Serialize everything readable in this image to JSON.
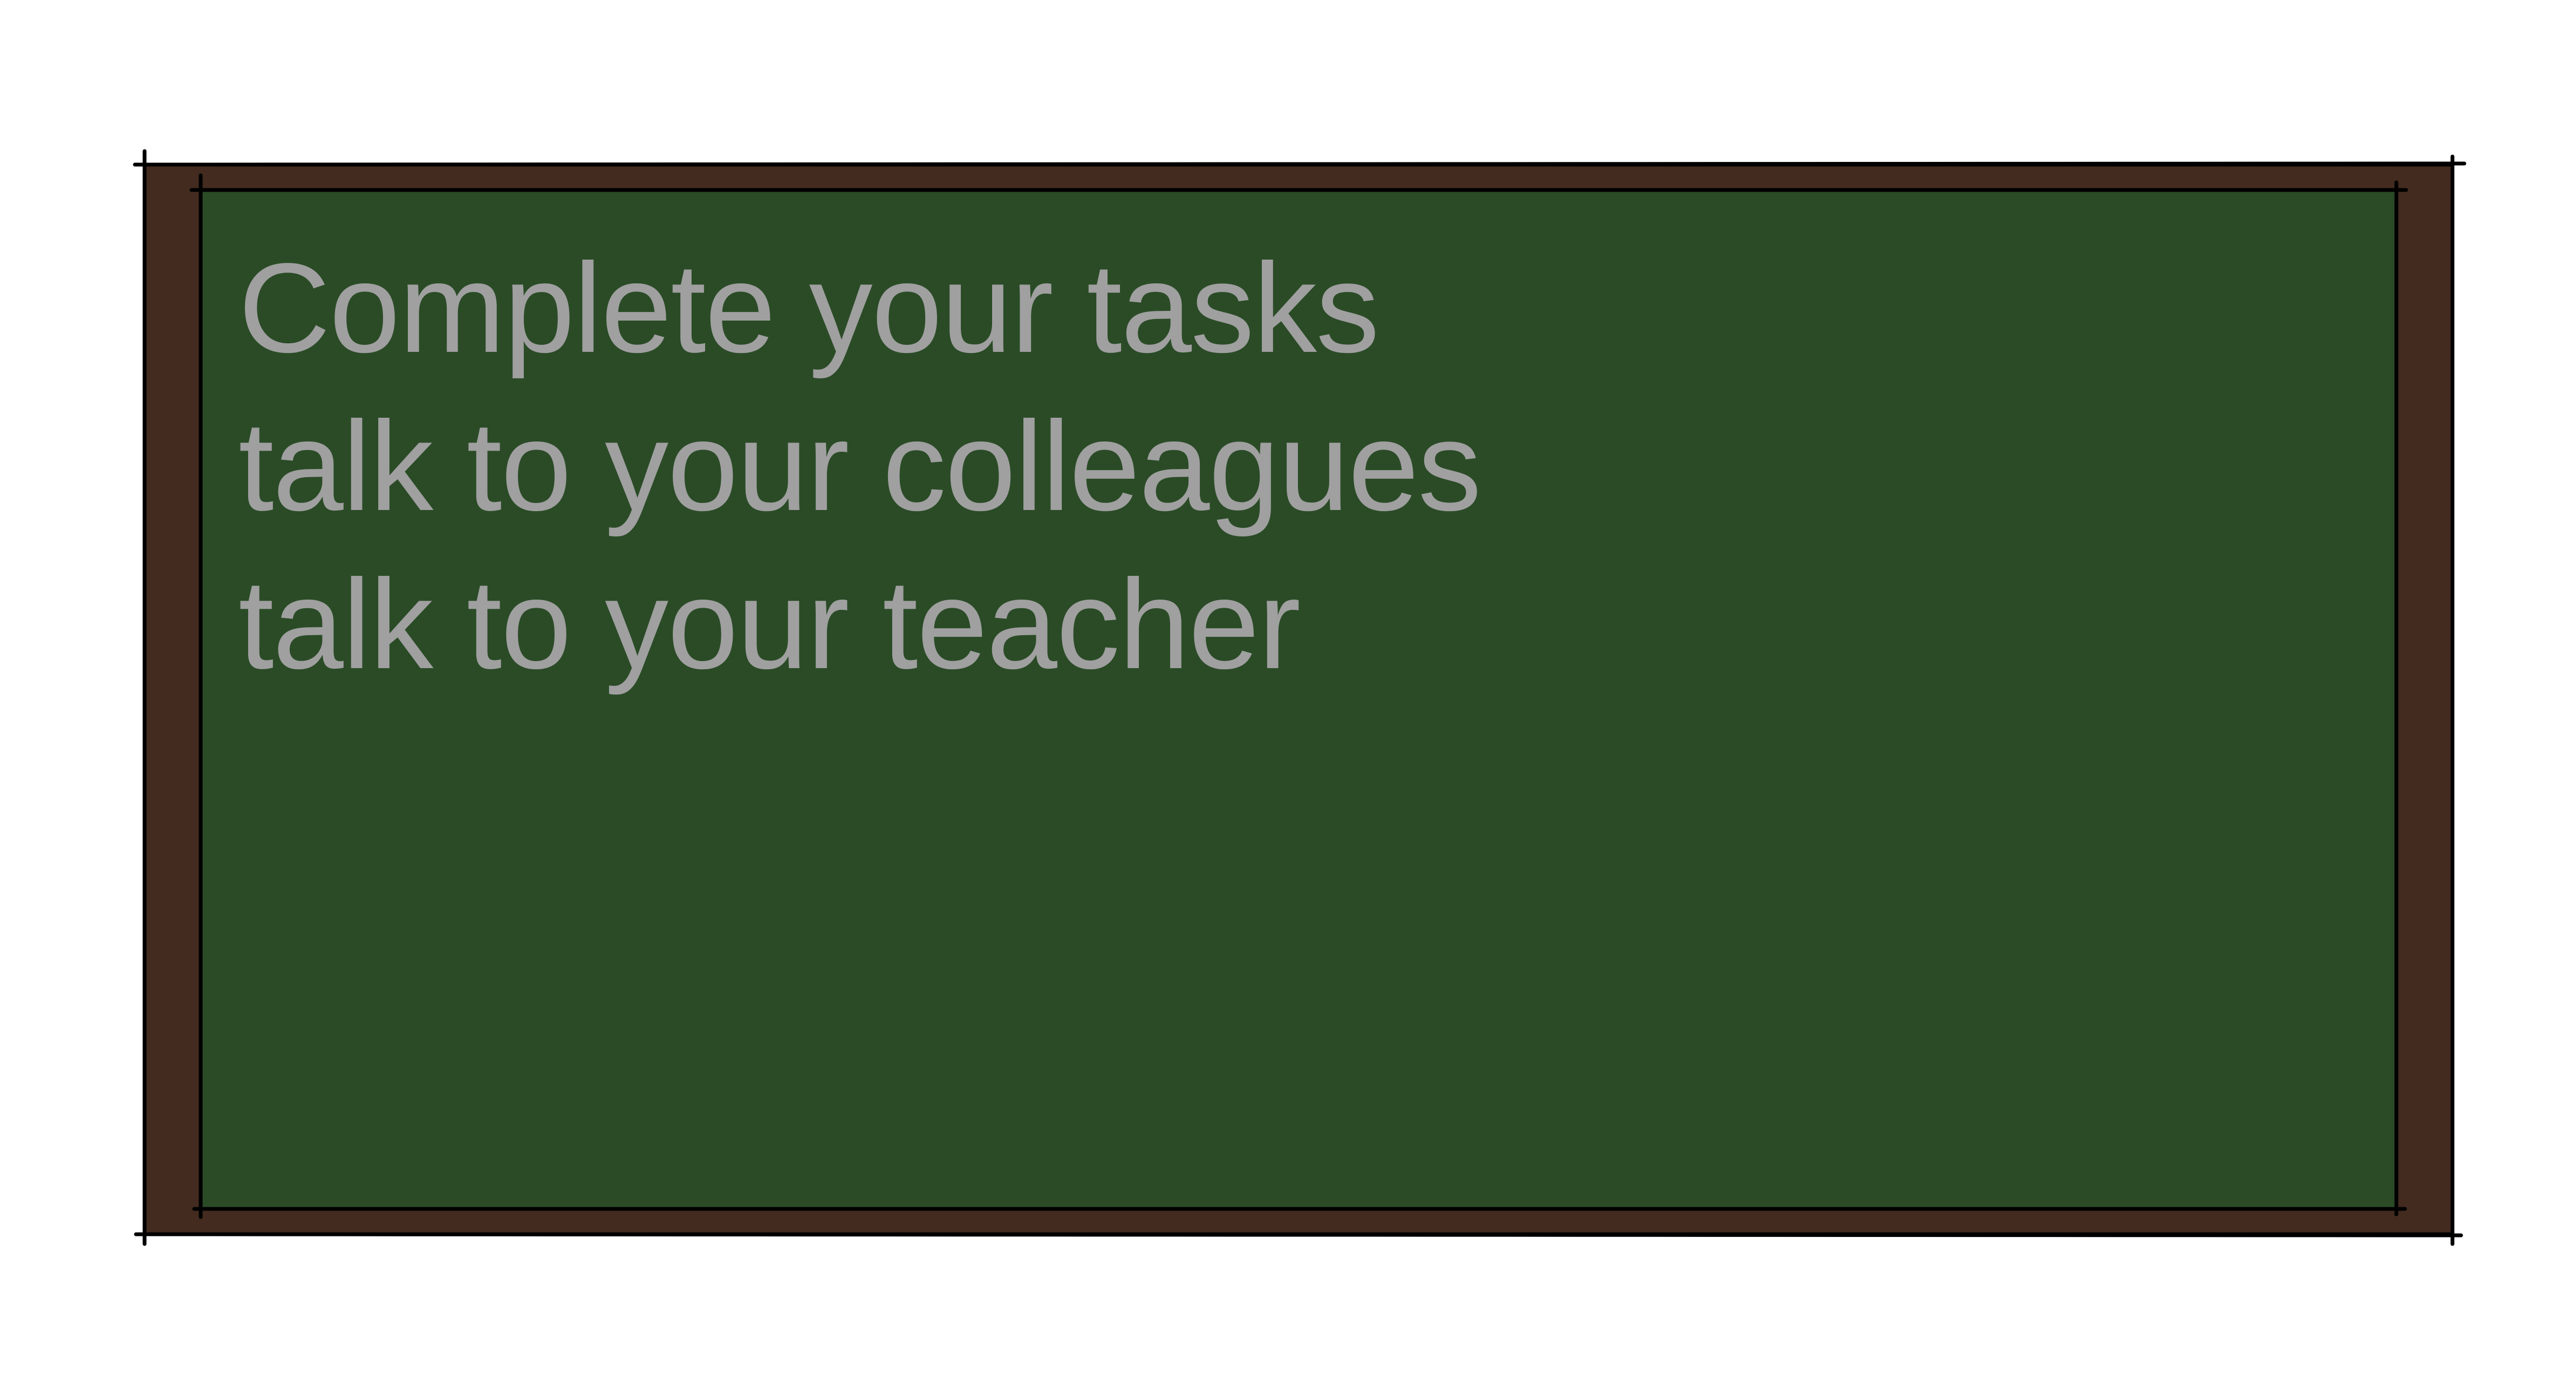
{
  "colors": {
    "background": "#ffffff",
    "frame": "#432b20",
    "board": "#2a4b26",
    "chalk_text": "#a0a0a0",
    "outline": "#000000"
  },
  "board": {
    "lines": [
      "Complete your tasks",
      "talk to your colleagues",
      "talk to your teacher"
    ]
  }
}
